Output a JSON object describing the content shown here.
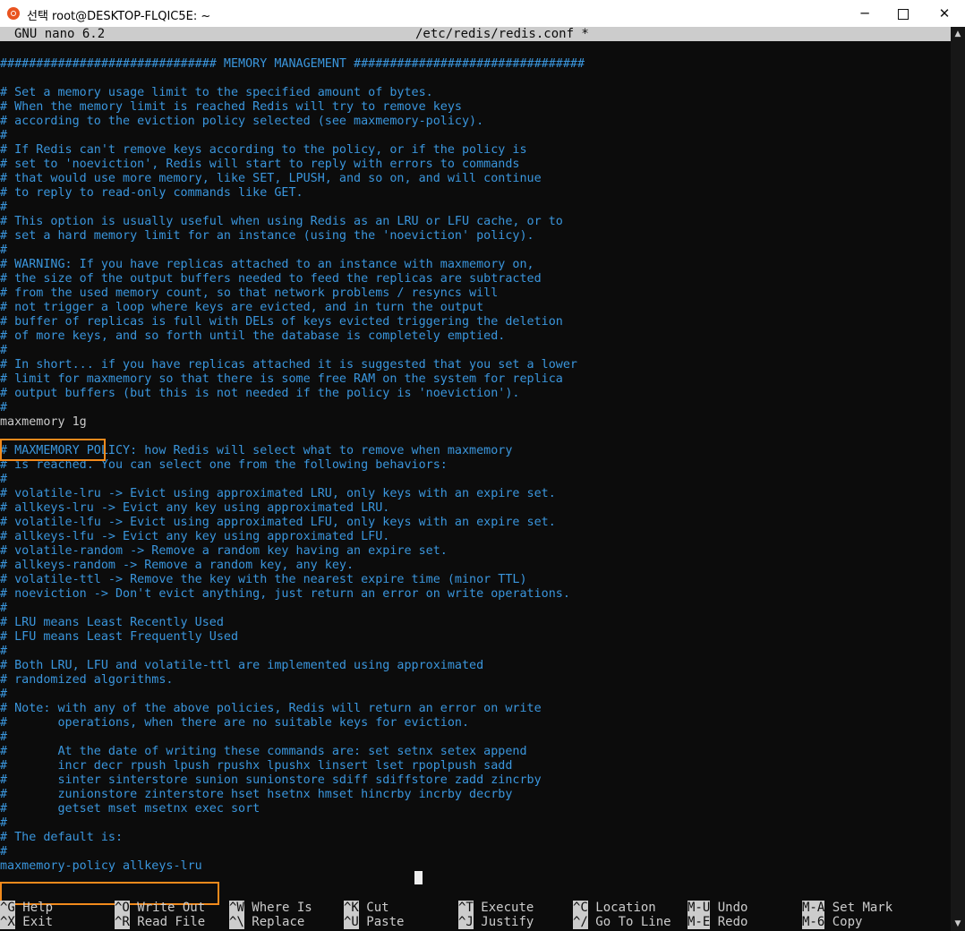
{
  "window": {
    "title": "선택 root@DESKTOP-FLQIC5E: ~",
    "minimize": "─",
    "close": "✕"
  },
  "nano": {
    "version": "GNU nano 6.2",
    "filename": "/etc/redis/redis.conf *"
  },
  "lines": [
    "############################## MEMORY MANAGEMENT ################################",
    "",
    "# Set a memory usage limit to the specified amount of bytes.",
    "# When the memory limit is reached Redis will try to remove keys",
    "# according to the eviction policy selected (see maxmemory-policy).",
    "#",
    "# If Redis can't remove keys according to the policy, or if the policy is",
    "# set to 'noeviction', Redis will start to reply with errors to commands",
    "# that would use more memory, like SET, LPUSH, and so on, and will continue",
    "# to reply to read-only commands like GET.",
    "#",
    "# This option is usually useful when using Redis as an LRU or LFU cache, or to",
    "# set a hard memory limit for an instance (using the 'noeviction' policy).",
    "#",
    "# WARNING: If you have replicas attached to an instance with maxmemory on,",
    "# the size of the output buffers needed to feed the replicas are subtracted",
    "# from the used memory count, so that network problems / resyncs will",
    "# not trigger a loop where keys are evicted, and in turn the output",
    "# buffer of replicas is full with DELs of keys evicted triggering the deletion",
    "# of more keys, and so forth until the database is completely emptied.",
    "#",
    "# In short... if you have replicas attached it is suggested that you set a lower",
    "# limit for maxmemory so that there is some free RAM on the system for replica",
    "# output buffers (but this is not needed if the policy is 'noeviction').",
    "#",
    "maxmemory 1g",
    "",
    "# MAXMEMORY POLICY: how Redis will select what to remove when maxmemory",
    "# is reached. You can select one from the following behaviors:",
    "#",
    "# volatile-lru -> Evict using approximated LRU, only keys with an expire set.",
    "# allkeys-lru -> Evict any key using approximated LRU.",
    "# volatile-lfu -> Evict using approximated LFU, only keys with an expire set.",
    "# allkeys-lfu -> Evict any key using approximated LFU.",
    "# volatile-random -> Remove a random key having an expire set.",
    "# allkeys-random -> Remove a random key, any key.",
    "# volatile-ttl -> Remove the key with the nearest expire time (minor TTL)",
    "# noeviction -> Don't evict anything, just return an error on write operations.",
    "#",
    "# LRU means Least Recently Used",
    "# LFU means Least Frequently Used",
    "#",
    "# Both LRU, LFU and volatile-ttl are implemented using approximated",
    "# randomized algorithms.",
    "#",
    "# Note: with any of the above policies, Redis will return an error on write",
    "#       operations, when there are no suitable keys for eviction.",
    "#",
    "#       At the date of writing these commands are: set setnx setex append",
    "#       incr decr rpush lpush rpushx lpushx linsert lset rpoplpush sadd",
    "#       sinter sinterstore sunion sunionstore sdiff sdiffstore zadd zincrby",
    "#       zunionstore zinterstore hset hsetnx hmset hincrby incrby decrby",
    "#       getset mset msetnx exec sort",
    "#",
    "# The default is:",
    "#",
    "maxmemory-policy allkeys-lru"
  ],
  "directive_lines": [
    25,
    57
  ],
  "shortcuts": [
    {
      "key": "^G",
      "label": "Help"
    },
    {
      "key": "^X",
      "label": "Exit"
    },
    {
      "key": "^O",
      "label": "Write Out"
    },
    {
      "key": "^R",
      "label": "Read File"
    },
    {
      "key": "^W",
      "label": "Where Is"
    },
    {
      "key": "^\\",
      "label": "Replace"
    },
    {
      "key": "^K",
      "label": "Cut"
    },
    {
      "key": "^U",
      "label": "Paste"
    },
    {
      "key": "^T",
      "label": "Execute"
    },
    {
      "key": "^J",
      "label": "Justify"
    },
    {
      "key": "^C",
      "label": "Location"
    },
    {
      "key": "^/",
      "label": "Go To Line"
    },
    {
      "key": "M-U",
      "label": "Undo"
    },
    {
      "key": "M-E",
      "label": "Redo"
    },
    {
      "key": "M-A",
      "label": "Set Mark"
    },
    {
      "key": "M-6",
      "label": "Copy"
    }
  ],
  "colors": {
    "comment": "#3a96dd",
    "text": "#cccccc",
    "background": "#0c0c0c",
    "highlight_box": "#f28a1c"
  }
}
